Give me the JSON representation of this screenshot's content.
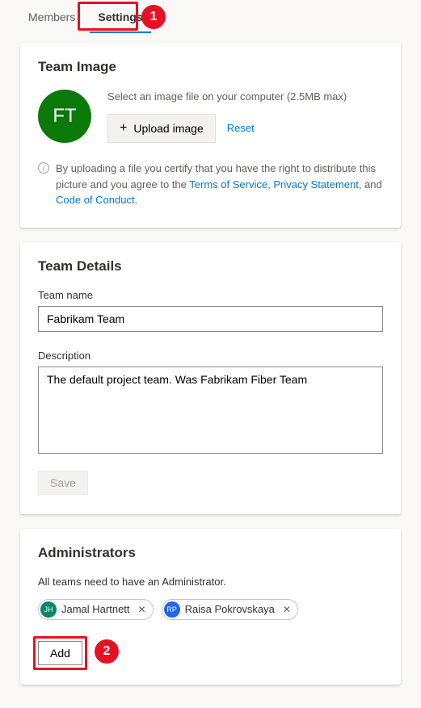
{
  "tabs": {
    "members": "Members",
    "settings": "Settings"
  },
  "callouts": {
    "one": "1",
    "two": "2"
  },
  "teamImage": {
    "heading": "Team Image",
    "initials": "FT",
    "selectPrompt": "Select an image file on your computer (2.5MB max)",
    "uploadLabel": "Upload image",
    "resetLabel": "Reset",
    "disclaimerPrefix": "By uploading a file you certify that you have the right to distribute this picture and you agree to the ",
    "tos": "Terms of Service",
    "comma1": ", ",
    "privacy": "Privacy Statement",
    "comma2": ", and ",
    "coc": "Code of Conduct",
    "period": "."
  },
  "teamDetails": {
    "heading": "Team Details",
    "nameLabel": "Team name",
    "nameValue": "Fabrikam Team",
    "descLabel": "Description",
    "descValue": "The default project team. Was Fabrikam Fiber Team",
    "saveLabel": "Save"
  },
  "admins": {
    "heading": "Administrators",
    "desc": "All teams need to have an Administrator.",
    "people": [
      {
        "initials": "JH",
        "name": "Jamal Hartnett",
        "color": "#028a67"
      },
      {
        "initials": "RP",
        "name": "Raisa Pokrovskaya",
        "color": "#2266e3"
      }
    ],
    "addLabel": "Add"
  }
}
